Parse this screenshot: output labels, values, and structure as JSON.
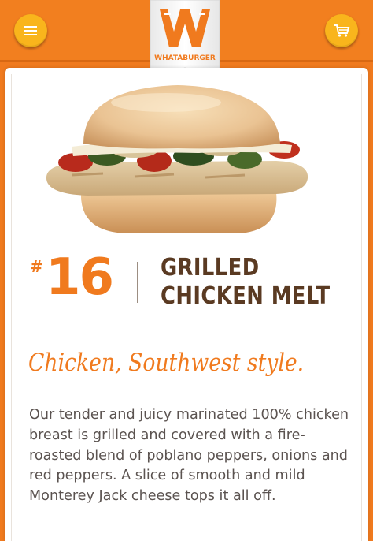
{
  "header": {
    "brand": "WHATABURGER",
    "menu_icon": "hamburger-menu-icon",
    "cart_icon": "shopping-cart-icon"
  },
  "item": {
    "hash": "#",
    "number": "16",
    "name": "GRILLED CHICKEN MELT",
    "tagline": "Chicken, Southwest style.",
    "description": "Our tender and juicy marinated 100% chicken breast is grilled and covered with a fire-roasted blend of poblano peppers, onions and red peppers. A slice of smooth and mild Monterey Jack cheese tops it all off."
  },
  "colors": {
    "brand_orange": "#f27f1f",
    "button_yellow": "#f9b51c",
    "title_brown": "#5a3a22",
    "text_gray": "#5b5350"
  }
}
